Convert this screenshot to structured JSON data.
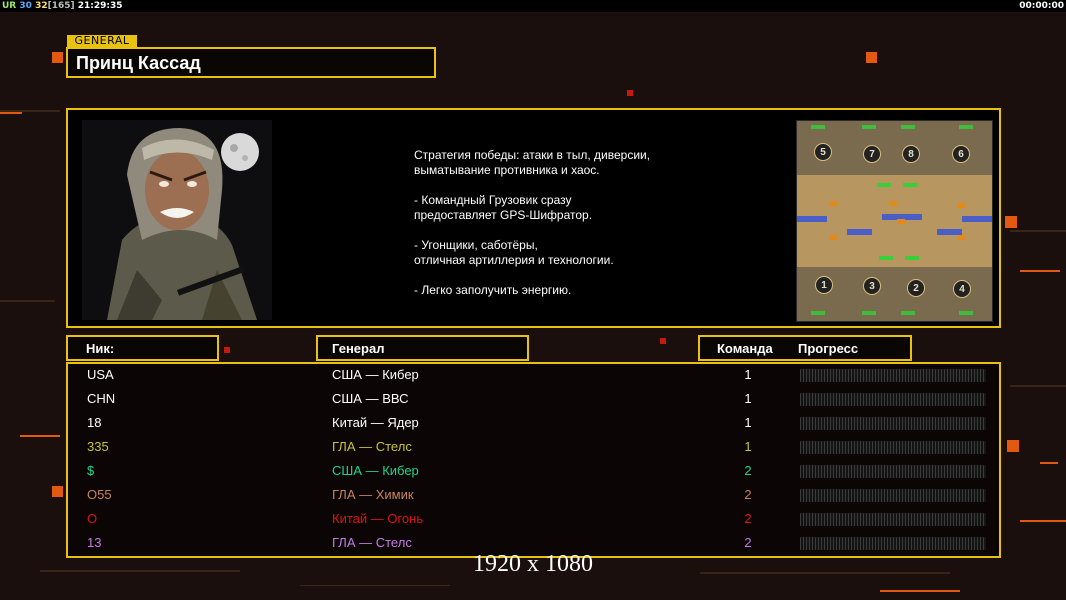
{
  "topbar": {
    "s1": "UR",
    "s2": "30",
    "s3": "32",
    "s4": "[165]",
    "clock": "21:29:35",
    "timer": "00:00:00"
  },
  "general_tag": "GENERAL",
  "general_name": "Принц Кассад",
  "strategy": [
    "Стратегия победы: атаки в тыл, диверсии,\n выматывание противника и хаос.",
    "- Командный Грузовик сразу\nпредоставляет GPS-Шифратор.",
    "- Угонщики, саботёры,\nотличная артиллерия и технологии.",
    "- Легко заполучить энергию."
  ],
  "minimap": {
    "starts": [
      "5",
      "7",
      "8",
      "6",
      "1",
      "3",
      "2",
      "4"
    ]
  },
  "headers": {
    "nick": "Ник:",
    "general": "Генерал",
    "team": "Команда",
    "progress": "Прогресс"
  },
  "players": [
    {
      "nick": "USA",
      "general": "США — Кибер",
      "team": "1",
      "color": "#ffffff",
      "progress": 0
    },
    {
      "nick": "CHN",
      "general": "США — ВВС",
      "team": "1",
      "color": "#ffffff",
      "progress": 0
    },
    {
      "nick": "18",
      "general": "Китай — Ядер",
      "team": "1",
      "color": "#ffffff",
      "progress": 0
    },
    {
      "nick": "335",
      "general": "ГЛА — Стелс",
      "team": "1",
      "color": "#c9c431",
      "progress": 0
    },
    {
      "nick": "$",
      "general": "США — Кибер",
      "team": "2",
      "color": "#1fd38e",
      "progress": 0
    },
    {
      "nick": "O55",
      "general": "ГЛА — Химик",
      "team": "2",
      "color": "#c9835a",
      "progress": 0
    },
    {
      "nick": "O",
      "general": "Китай — Огонь",
      "team": "2",
      "color": "#e01212",
      "progress": 0
    },
    {
      "nick": "13",
      "general": "ГЛА — Стелс",
      "team": "2",
      "color": "#c57be6",
      "progress": 0
    }
  ],
  "resolution": "1920 x 1080",
  "colors": {
    "frame": "#e8c20e",
    "accent": "#e2590f",
    "background": "#1a0f0c"
  }
}
